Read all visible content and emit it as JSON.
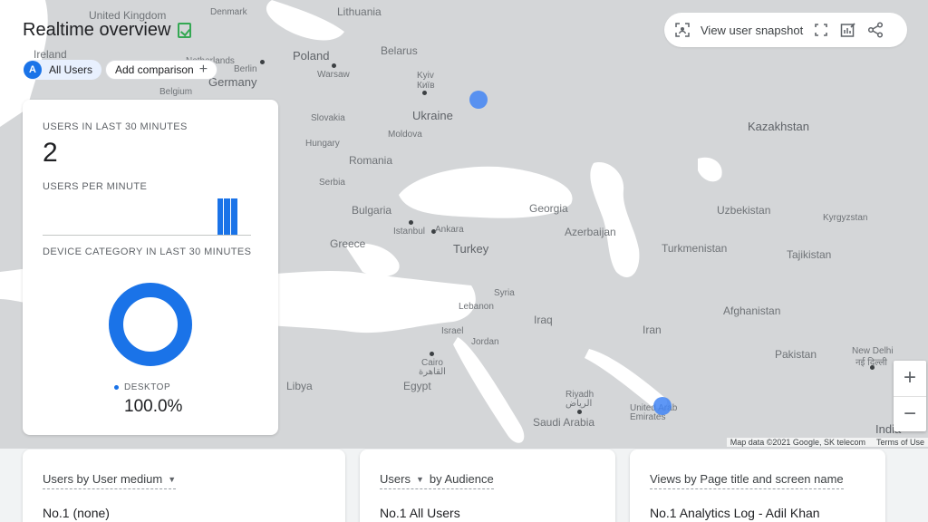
{
  "title": "Realtime overview",
  "filters": {
    "all_users_badge": "A",
    "all_users_label": "All Users",
    "add_comparison_label": "Add comparison"
  },
  "toolbar": {
    "snapshot_label": "View user snapshot",
    "icons": [
      "snapshot-icon",
      "fullscreen-icon",
      "customize-report-icon",
      "share-icon"
    ]
  },
  "map": {
    "labels": {
      "united_kingdom": "United Kingdom",
      "ireland": "Ireland",
      "denmark": "Denmark",
      "lithuania": "Lithuania",
      "poland": "Poland",
      "belarus": "Belarus",
      "warsaw": "Warsaw",
      "berlin": "Berlin",
      "germany": "Germany",
      "netherlands": "Netherlands",
      "belgium": "Belgium",
      "kyiv": "Kyiv",
      "kyiv_local": "Київ",
      "ukraine": "Ukraine",
      "slovakia": "Slovakia",
      "hungary": "Hungary",
      "moldova": "Moldova",
      "romania": "Romania",
      "serbia": "Serbia",
      "bulgaria": "Bulgaria",
      "kazakhstan": "Kazakhstan",
      "georgia": "Georgia",
      "azerbaijan": "Azerbaijan",
      "uzbekistan": "Uzbekistan",
      "kyrgyzstan": "Kyrgyzstan",
      "turkmenistan": "Turkmenistan",
      "tajikistan": "Tajikistan",
      "istanbul": "Istanbul",
      "ankara": "Ankara",
      "turkey": "Turkey",
      "greece": "Greece",
      "syria": "Syria",
      "lebanon": "Lebanon",
      "israel": "Israel",
      "jordan": "Jordan",
      "iraq": "Iraq",
      "iran": "Iran",
      "afghanistan": "Afghanistan",
      "pakistan": "Pakistan",
      "new_delhi": "New Delhi",
      "new_delhi_local": "नई दिल्ली",
      "libya": "Libya",
      "egypt": "Egypt",
      "cairo": "Cairo",
      "cairo_local": "القاهرة",
      "riyadh": "Riyadh",
      "riyadh_local": "الرياض",
      "saudi_arabia": "Saudi Arabia",
      "uae": "United Arab Emirates",
      "india": "India"
    },
    "attribution": "Map data ©2021 Google, SK telecom",
    "terms": "Terms of Use",
    "zoom_in": "+",
    "zoom_out": "−"
  },
  "card": {
    "users_caption": "USERS IN LAST 30 MINUTES",
    "users_value": "2",
    "per_minute_caption": "USERS PER MINUTE",
    "users_per_minute": [
      0,
      0,
      0,
      0,
      0,
      0,
      0,
      0,
      0,
      0,
      0,
      0,
      0,
      0,
      0,
      0,
      0,
      0,
      0,
      0,
      0,
      0,
      0,
      0,
      0,
      1,
      1,
      1,
      0,
      0
    ],
    "device_caption": "DEVICE CATEGORY IN LAST 30 MINUTES",
    "device_legend": "DESKTOP",
    "device_percent": "100.0%",
    "device_share": 1.0,
    "accent_color": "#1a73e8"
  },
  "bottom": {
    "medium": {
      "header": "Users by User medium",
      "row": "No.1  (none)"
    },
    "audience": {
      "header_metric": "Users",
      "header_rest": "by Audience",
      "row": "No.1  All Users"
    },
    "views": {
      "header": "Views by Page title and screen name",
      "row": "No.1  Analytics Log - Adil Khan"
    }
  }
}
